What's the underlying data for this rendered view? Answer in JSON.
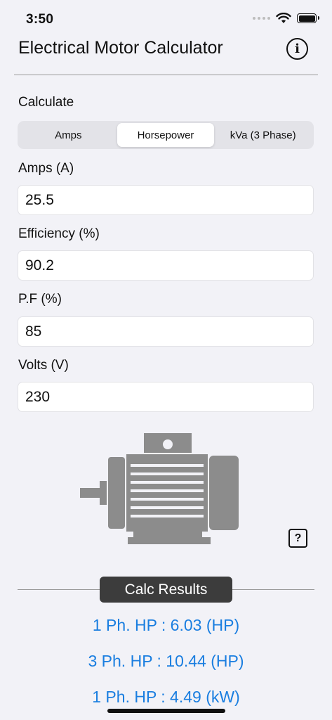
{
  "status": {
    "time": "3:50"
  },
  "nav": {
    "title": "Electrical Motor Calculator",
    "info_icon": "i"
  },
  "calculate": {
    "label": "Calculate",
    "segments": [
      "Amps",
      "Horsepower",
      "kVa (3 Phase)"
    ],
    "selected": "Horsepower"
  },
  "fields": {
    "amps": {
      "label": "Amps (A)",
      "value": "25.5"
    },
    "efficiency": {
      "label": "Efficiency (%)",
      "value": "90.2"
    },
    "pf": {
      "label": "P.F (%)",
      "value": "85"
    },
    "volts": {
      "label": "Volts (V)",
      "value": "230"
    }
  },
  "help_icon": "?",
  "results": {
    "title": "Calc Results",
    "lines": [
      "1 Ph. HP : 6.03 (HP)",
      "3 Ph. HP : 10.44 (HP)",
      "1 Ph. HP : 4.49 (kW)"
    ]
  },
  "colors": {
    "accent": "#1a7ee0",
    "badge": "#3c3c3c",
    "motor": "#8c8c8c",
    "background": "#f2f2f7"
  }
}
